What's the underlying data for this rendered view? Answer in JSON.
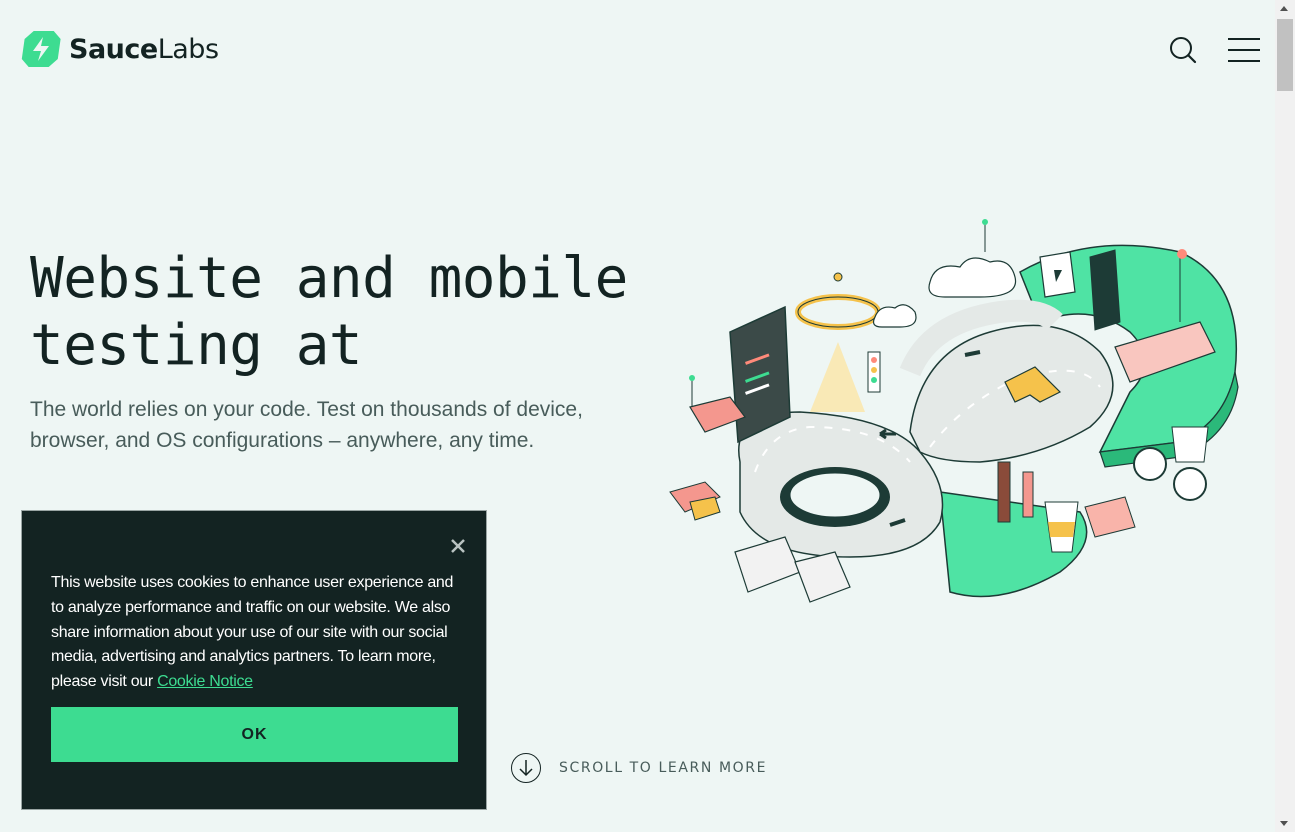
{
  "header": {
    "logo_bold": "Sauce",
    "logo_light": "Labs",
    "search_icon": "search-icon",
    "menu_icon": "hamburger-menu-icon"
  },
  "hero": {
    "title": "Website and mobile testing at",
    "subtitle": "The world relies on your code. Test on thousands of device, browser, and OS configurations – anywhere, any time."
  },
  "scroll_cta": {
    "icon": "arrow-down-circle-icon",
    "label": "SCROLL TO LEARN MORE"
  },
  "cookie_banner": {
    "text": "This website uses cookies to enhance user experience and to analyze performance and traffic on our website. We also share information about your use of our site with our social media, advertising and analytics partners. To learn more, please visit our ",
    "link_text": "Cookie Notice",
    "ok_label": "OK",
    "close_icon": "close-icon"
  },
  "colors": {
    "background": "#eef6f4",
    "brand_green": "#3ddc91",
    "dark": "#132322",
    "muted_text": "#485c5a"
  }
}
